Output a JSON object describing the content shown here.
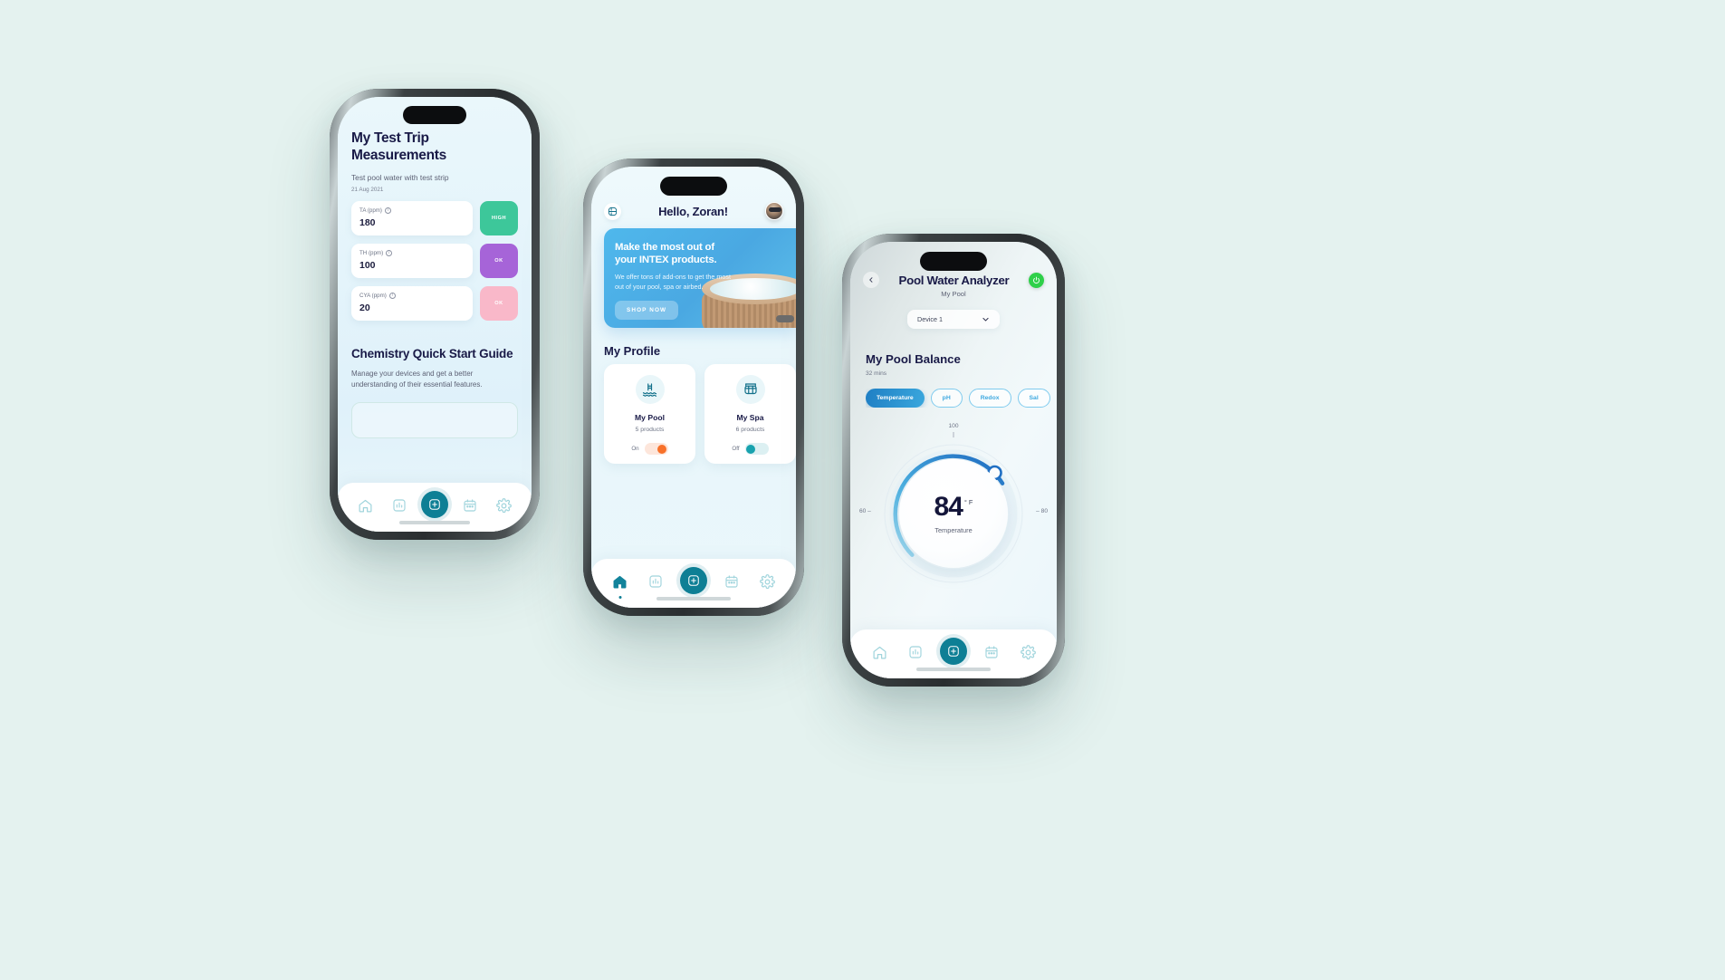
{
  "phone1": {
    "title": "My Test Trip Measurements",
    "subtitle": "Test pool water with test strip",
    "date": "21 Aug 2021",
    "measurements": [
      {
        "label": "TA (ppm)",
        "value": "180",
        "status": "HIGH",
        "status_color": "#3dc79a"
      },
      {
        "label": "TH (ppm)",
        "value": "100",
        "status": "OK",
        "status_color": "#a664d8"
      },
      {
        "label": "CYA (ppm)",
        "value": "20",
        "status": "OK",
        "status_color": "#f9b8c9"
      }
    ],
    "guide_title": "Chemistry Quick Start Guide",
    "guide_text": "Manage your devices and get a better understanding of their essential features.",
    "nav": [
      {
        "icon": "home-icon",
        "active": false
      },
      {
        "icon": "chart-icon",
        "active": false
      },
      {
        "icon": "add-icon",
        "active": true
      },
      {
        "icon": "calendar-icon",
        "active": false
      },
      {
        "icon": "gear-icon",
        "active": false
      }
    ]
  },
  "phone2": {
    "menu_icon": "menu-icon",
    "greeting": "Hello, Zoran!",
    "avatar": "user-avatar",
    "banner": {
      "heading": "Make the most out of your INTEX products.",
      "body": "We offer tons of add-ons to get the most out of your pool, spa or airbed.",
      "cta": "SHOP NOW",
      "bg_color": "#4fb8ec"
    },
    "section_title": "My Profile",
    "cards": [
      {
        "icon": "pool-ladder-icon",
        "name": "My Pool",
        "count": "5 products",
        "toggle_label": "On",
        "toggle_on": true,
        "toggle_color": "#f8712a"
      },
      {
        "icon": "spa-icon",
        "name": "My Spa",
        "count": "6 products",
        "toggle_label": "Off",
        "toggle_on": false,
        "toggle_color": "#18a2ae"
      }
    ],
    "nav": [
      {
        "icon": "home-icon",
        "active": true
      },
      {
        "icon": "chart-icon",
        "active": false
      },
      {
        "icon": "add-icon",
        "active": true
      },
      {
        "icon": "calendar-icon",
        "active": false
      },
      {
        "icon": "gear-icon",
        "active": false
      }
    ]
  },
  "phone3": {
    "back_icon": "chevron-left-icon",
    "title": "Pool Water Analyzer",
    "power_icon": "power-icon",
    "power_color": "#2fd04a",
    "subtitle": "My Pool",
    "device": "Device 1",
    "device_chevron": "chevron-down-icon",
    "balance_title": "My Pool Balance",
    "balance_time": "32 mins",
    "tabs": [
      {
        "label": "Temperature",
        "active": true
      },
      {
        "label": "pH",
        "active": false
      },
      {
        "label": "Redox",
        "active": false
      },
      {
        "label": "Sal",
        "active": false
      }
    ],
    "gauge": {
      "min_label": "60",
      "max_label": "80",
      "top_label": "100",
      "value": "84",
      "unit": "° F",
      "caption": "Temperature",
      "arc_color": "#1f86cf"
    },
    "nav": [
      {
        "icon": "home-icon",
        "active": false
      },
      {
        "icon": "chart-icon",
        "active": false
      },
      {
        "icon": "add-icon",
        "active": true
      },
      {
        "icon": "calendar-icon",
        "active": false
      },
      {
        "icon": "gear-icon",
        "active": false
      }
    ]
  },
  "chart_data": {
    "type": "gauge",
    "title": "Temperature",
    "value": 84,
    "unit": "°F",
    "min": 60,
    "max": 100,
    "ticks": [
      60,
      80,
      100
    ],
    "arc_color": "#1f86cf"
  }
}
